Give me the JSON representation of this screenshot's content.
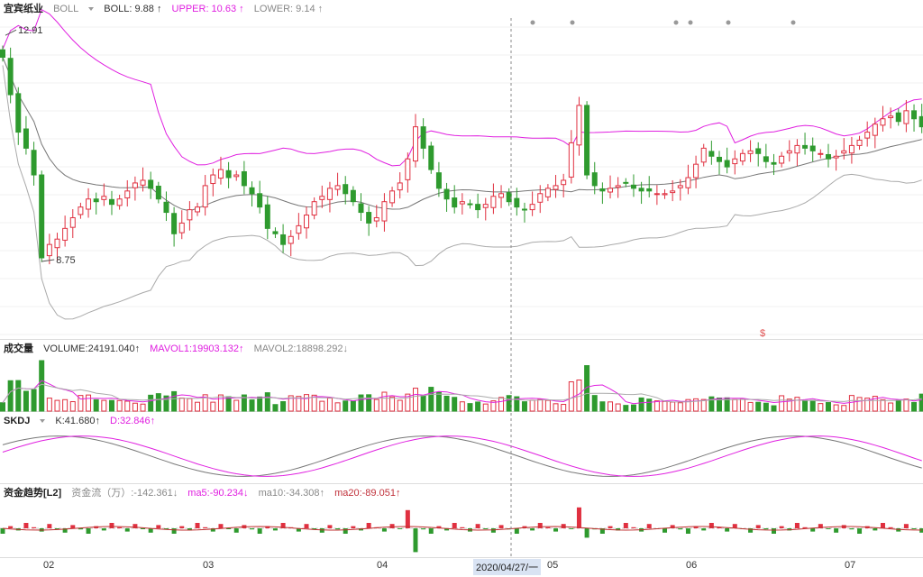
{
  "header_main": {
    "stock": "宜宾纸业",
    "indicator_select": "BOLL",
    "boll": "BOLL: 9.88 ↑",
    "upper": "UPPER: 10.63 ↑",
    "lower": "LOWER: 9.14 ↑"
  },
  "header_volume": {
    "name": "成交量",
    "volume": "VOLUME:24191.040↑",
    "mavol1": "MAVOL1:19903.132↑",
    "mavol2": "MAVOL2:18898.292↓"
  },
  "header_skdj": {
    "name": "SKDJ",
    "k": "K:41.680↑",
    "d": "D:32.846↑"
  },
  "header_fund": {
    "name": "资金趋势[L2]",
    "flow": "资金流（万）:-142.361↓",
    "ma5": "ma5:-90.234↓",
    "ma10": "ma10:-34.308↑",
    "ma20": "ma20:-89.051↑"
  },
  "annotations": {
    "high": "12.91",
    "low": "8.75",
    "dollar": "$"
  },
  "x_axis": {
    "months": [
      "02",
      "03",
      "04",
      "05",
      "06",
      "07"
    ],
    "cursor_date": "2020/04/27/一"
  },
  "colors": {
    "up": "#e03040",
    "down": "#2e9a2e",
    "boll_upper": "#e020e0",
    "boll_mid": "#777777",
    "boll_lower": "#aaaaaa"
  },
  "chart_data": {
    "type": "candlestick",
    "price_series": "approximate daily K-line, boll bands",
    "price_range": [
      7.3,
      13.2
    ],
    "high_marked": 12.91,
    "low_marked": 8.75,
    "boll_last": {
      "boll": 9.88,
      "upper": 10.63,
      "lower": 9.14
    },
    "volume_last": {
      "volume": 24191.04,
      "mavol1": 19903.132,
      "mavol2": 18898.292
    },
    "skdj_last": {
      "k": 41.68,
      "d": 32.846
    },
    "fund_last": {
      "flow": -142.361,
      "ma5": -90.234,
      "ma10": -34.308,
      "ma20": -89.051
    },
    "closes": [
      12.5,
      11.8,
      11.1,
      10.8,
      10.3,
      8.75,
      9.0,
      9.1,
      9.3,
      9.5,
      9.7,
      9.85,
      9.8,
      9.9,
      9.75,
      9.85,
      10.0,
      10.15,
      10.2,
      10.05,
      9.85,
      9.6,
      9.2,
      9.4,
      9.65,
      9.7,
      10.1,
      10.3,
      10.4,
      10.25,
      10.3,
      10.1,
      9.95,
      9.7,
      9.3,
      9.2,
      9.0,
      9.15,
      9.35,
      9.55,
      9.8,
      9.9,
      10.05,
      10.1,
      9.95,
      9.8,
      9.6,
      9.4,
      9.5,
      9.8,
      10.0,
      10.15,
      10.6,
      11.2,
      10.8,
      10.4,
      10.05,
      9.85,
      9.7,
      9.8,
      9.75,
      9.65,
      9.75,
      9.9,
      9.95,
      9.8,
      9.7,
      9.65,
      9.75,
      9.95,
      10.05,
      10.1,
      10.2,
      10.9,
      11.6,
      10.3,
      10.1,
      10.0,
      10.05,
      10.1,
      10.15,
      10.05,
      10.0,
      10.0,
      9.95,
      9.95,
      10.0,
      10.1,
      10.25,
      10.5,
      10.8,
      10.65,
      10.55,
      10.45,
      10.6,
      10.7,
      10.75,
      10.7,
      10.55,
      10.5,
      10.65,
      10.75,
      10.85,
      10.8,
      10.75,
      10.7,
      10.6,
      10.65,
      10.75,
      10.85,
      10.95,
      11.1,
      11.25,
      11.35,
      11.4,
      11.3,
      11.5,
      11.35,
      11.2
    ]
  }
}
